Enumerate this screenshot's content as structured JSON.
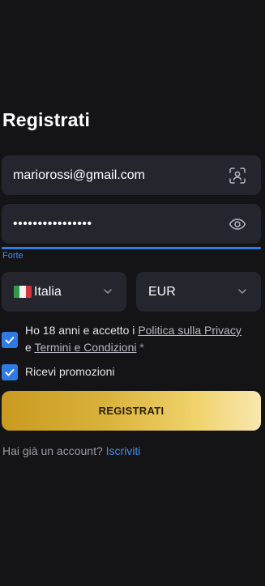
{
  "title": "Registrati",
  "email": {
    "value": "mariorossi@gmail.com",
    "icon": "face-scan-icon"
  },
  "password": {
    "masked_value": "••••••••••••••••",
    "icon": "eye-icon"
  },
  "strength": {
    "label": "Forte",
    "level": 1.0,
    "color": "#2f7ae5"
  },
  "country": {
    "selected": "Italia",
    "flag": "italy-flag"
  },
  "currency": {
    "selected": "EUR"
  },
  "terms": {
    "checked": true,
    "prefix": "Ho 18 anni e accetto i ",
    "privacy_link": "Politica sulla Privacy",
    "connector": "e ",
    "terms_link": "Termini e Condizioni",
    "required_mark": " *"
  },
  "promotions": {
    "checked": true,
    "label": "Ricevi promozioni"
  },
  "register_button": {
    "label": "REGISTRATI"
  },
  "login_prompt": {
    "text": "Hai già un account? ",
    "link": "Iscriviti"
  },
  "colors": {
    "background": "#141416",
    "field": "#25252e",
    "accent_blue": "#2f7ae5",
    "gold_start": "#c99a1f",
    "gold_end": "#f8e7b0"
  }
}
